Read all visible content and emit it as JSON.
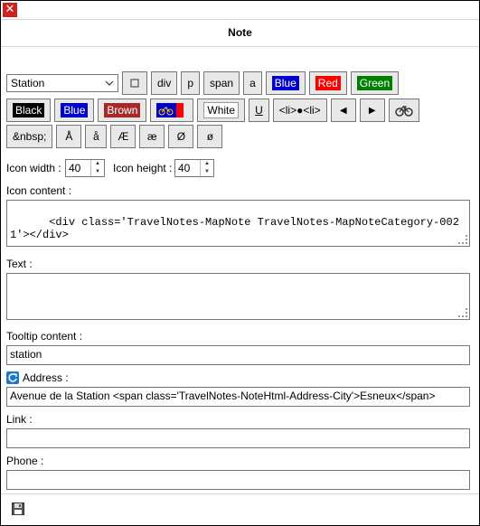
{
  "dialog": {
    "close_glyph": "✕",
    "title": "Note"
  },
  "toolbar": {
    "category_select": "Station",
    "row1": [
      "div",
      "p",
      "span",
      "a"
    ],
    "blue": "Blue",
    "red": "Red",
    "green": "Green",
    "black": "Black",
    "blue2": "Blue",
    "brown": "Brown",
    "white": "White",
    "underline": "U",
    "list": "<li>●<li>",
    "arrow_left": "◀",
    "arrow_right": "▶",
    "chars": [
      "&nbsp;",
      "Å",
      "å",
      "Æ",
      "æ",
      "Ø",
      "ø"
    ]
  },
  "colors": {
    "blue": "#0000cc",
    "red": "#ff0000",
    "green": "#008000",
    "black": "#000000",
    "brown": "#a52a2a"
  },
  "icon": {
    "width_label": "Icon width :",
    "width_value": "40",
    "height_label": "Icon height :",
    "height_value": "40"
  },
  "icon_content": {
    "label": "Icon content :",
    "value": "<div class='TravelNotes-MapNote TravelNotes-MapNoteCategory-0021'></div>"
  },
  "text": {
    "label": "Text :",
    "value": ""
  },
  "tooltip": {
    "label": "Tooltip content :",
    "value": "station"
  },
  "address": {
    "label": "Address :",
    "value": "Avenue de la Station <span class='TravelNotes-NoteHtml-Address-City'>Esneux</span>"
  },
  "link": {
    "label": "Link :",
    "value": ""
  },
  "phone": {
    "label": "Phone :",
    "value": ""
  },
  "icons": [
    "close-icon",
    "dropdown-chevron-icon",
    "square-icon",
    "bike-icon",
    "arrow-left-icon",
    "arrow-right-icon",
    "refresh-icon",
    "save-icon"
  ]
}
